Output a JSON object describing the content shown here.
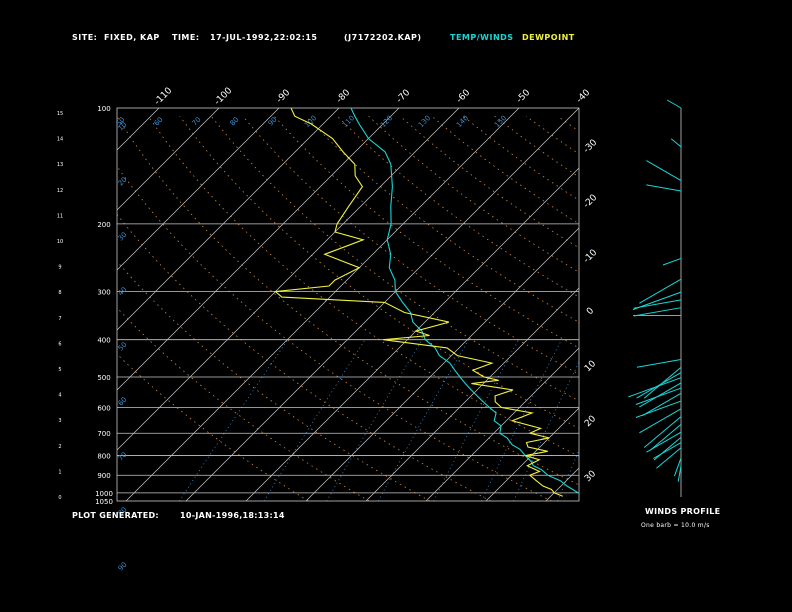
{
  "header": {
    "site_label": "SITE:",
    "site_value": "FIXED, KAP",
    "time_label": "TIME:",
    "time_value": "17-JUL-1992,22:02:15",
    "file": "(J7172202.KAP)",
    "legend_temp": "TEMP/WINDS",
    "legend_dew": "DEWPOINT"
  },
  "footer": {
    "generated_label": "PLOT GENERATED:",
    "generated_value": "10-JAN-1996,18:13:14",
    "winds_profile": "WINDS PROFILE",
    "barb_note": "One barb = 10.0 m/s"
  },
  "colors": {
    "background": "#000000",
    "grid": "#c8c8c8",
    "temperature": "#18d6d6",
    "dewpoint": "#f0f040",
    "dry_adiabat": "#d08838",
    "mixing_ratio": "#3a8fd0",
    "moist": "#d0a050"
  },
  "chart_data": {
    "type": "line",
    "title": "",
    "pressure_levels": [
      100,
      200,
      300,
      400,
      500,
      600,
      700,
      800,
      900,
      1000,
      1050
    ],
    "pressure_tick_labels": [
      "100",
      "200",
      "300",
      "400",
      "500",
      "600",
      "700",
      "800",
      "900",
      "1000",
      "1050"
    ],
    "height_ticks": [
      "15",
      "14",
      "13",
      "12",
      "11",
      "10",
      "9",
      "8",
      "7",
      "6",
      "5",
      "4",
      "3",
      "2",
      "1",
      "0"
    ],
    "top_skew_labels": [
      "-110",
      "-100",
      "-90",
      "-80",
      "-70",
      "-60",
      "-50",
      "-40"
    ],
    "right_skew_labels": [
      "-30",
      "-20",
      "-10",
      "0",
      "10",
      "20",
      "30"
    ],
    "dry_adiabat_labels": [
      "20",
      "50",
      "60",
      "70",
      "80",
      "90",
      "100",
      "110",
      "120",
      "130",
      "140",
      "150"
    ],
    "mixing_ratio_labels": [
      "10",
      "30",
      "40",
      "50",
      "60",
      "70",
      "80",
      "90",
      "100",
      "110",
      "120",
      "130",
      "140"
    ],
    "series": [
      {
        "name": "TEMP/WINDS",
        "pressure": [
          1020,
          1000,
          960,
          930,
          900,
          870,
          850,
          830,
          800,
          770,
          750,
          720,
          700,
          670,
          650,
          620,
          600,
          580,
          560,
          540,
          520,
          500,
          480,
          460,
          440,
          420,
          400,
          380,
          360,
          340,
          320,
          300,
          280,
          260,
          240,
          220,
          200,
          180,
          160,
          140,
          130,
          120,
          110,
          105,
          100
        ],
        "temperature": [
          27,
          24,
          21,
          19,
          16,
          14,
          12,
          11,
          9,
          7,
          5,
          3,
          1,
          0,
          -2,
          -3,
          -5,
          -7,
          -9,
          -11,
          -13,
          -15,
          -17,
          -19,
          -22,
          -24,
          -27,
          -29,
          -32,
          -34,
          -37,
          -40,
          -42,
          -45,
          -47,
          -50,
          -52,
          -55,
          -58,
          -62,
          -65,
          -70,
          -74,
          -76,
          -78
        ]
      },
      {
        "name": "DEWPOINT",
        "pressure": [
          1020,
          1000,
          980,
          960,
          930,
          900,
          880,
          850,
          820,
          800,
          780,
          760,
          740,
          720,
          700,
          680,
          650,
          620,
          600,
          580,
          560,
          540,
          520,
          510,
          500,
          480,
          460,
          440,
          420,
          410,
          400,
          390,
          380,
          360,
          340,
          320,
          310,
          300,
          290,
          280,
          260,
          240,
          220,
          210,
          200,
          180,
          160,
          150,
          140,
          130,
          120,
          110,
          105,
          100
        ],
        "dewpoint": [
          22,
          20,
          19,
          17,
          15,
          13,
          14,
          11,
          12,
          9,
          12,
          8,
          7,
          10,
          6,
          7,
          1,
          3,
          -3,
          -5,
          -6,
          -4,
          -12,
          -8,
          -11,
          -14,
          -12,
          -19,
          -22,
          -28,
          -34,
          -27,
          -30,
          -26,
          -35,
          -40,
          -58,
          -60,
          -52,
          -52,
          -50,
          -58,
          -54,
          -60,
          -61,
          -62,
          -63,
          -66,
          -68,
          -72,
          -76,
          -82,
          -86,
          -88
        ]
      }
    ],
    "wind_profile": {
      "height_km": [
        15,
        13.5,
        12.2,
        11.8,
        9.2,
        8.4,
        7.9,
        7.6,
        7.3,
        7.0,
        5.3,
        5.0,
        4.8,
        4.6,
        4.4,
        4.2,
        4.0,
        3.7,
        3.4,
        3.1,
        2.8,
        2.5,
        2.3,
        2.1,
        1.9,
        1.5,
        1.2
      ],
      "direction_deg": [
        300,
        310,
        300,
        280,
        250,
        240,
        250,
        260,
        260,
        270,
        260,
        230,
        240,
        250,
        240,
        250,
        240,
        250,
        240,
        230,
        230,
        240,
        230,
        240,
        230,
        200,
        190
      ],
      "speed_ms": [
        10,
        8,
        25,
        22,
        12,
        30,
        32,
        30,
        30,
        30,
        28,
        30,
        32,
        35,
        30,
        30,
        28,
        30,
        30,
        30,
        25,
        25,
        22,
        20,
        20,
        12,
        10
      ]
    }
  }
}
